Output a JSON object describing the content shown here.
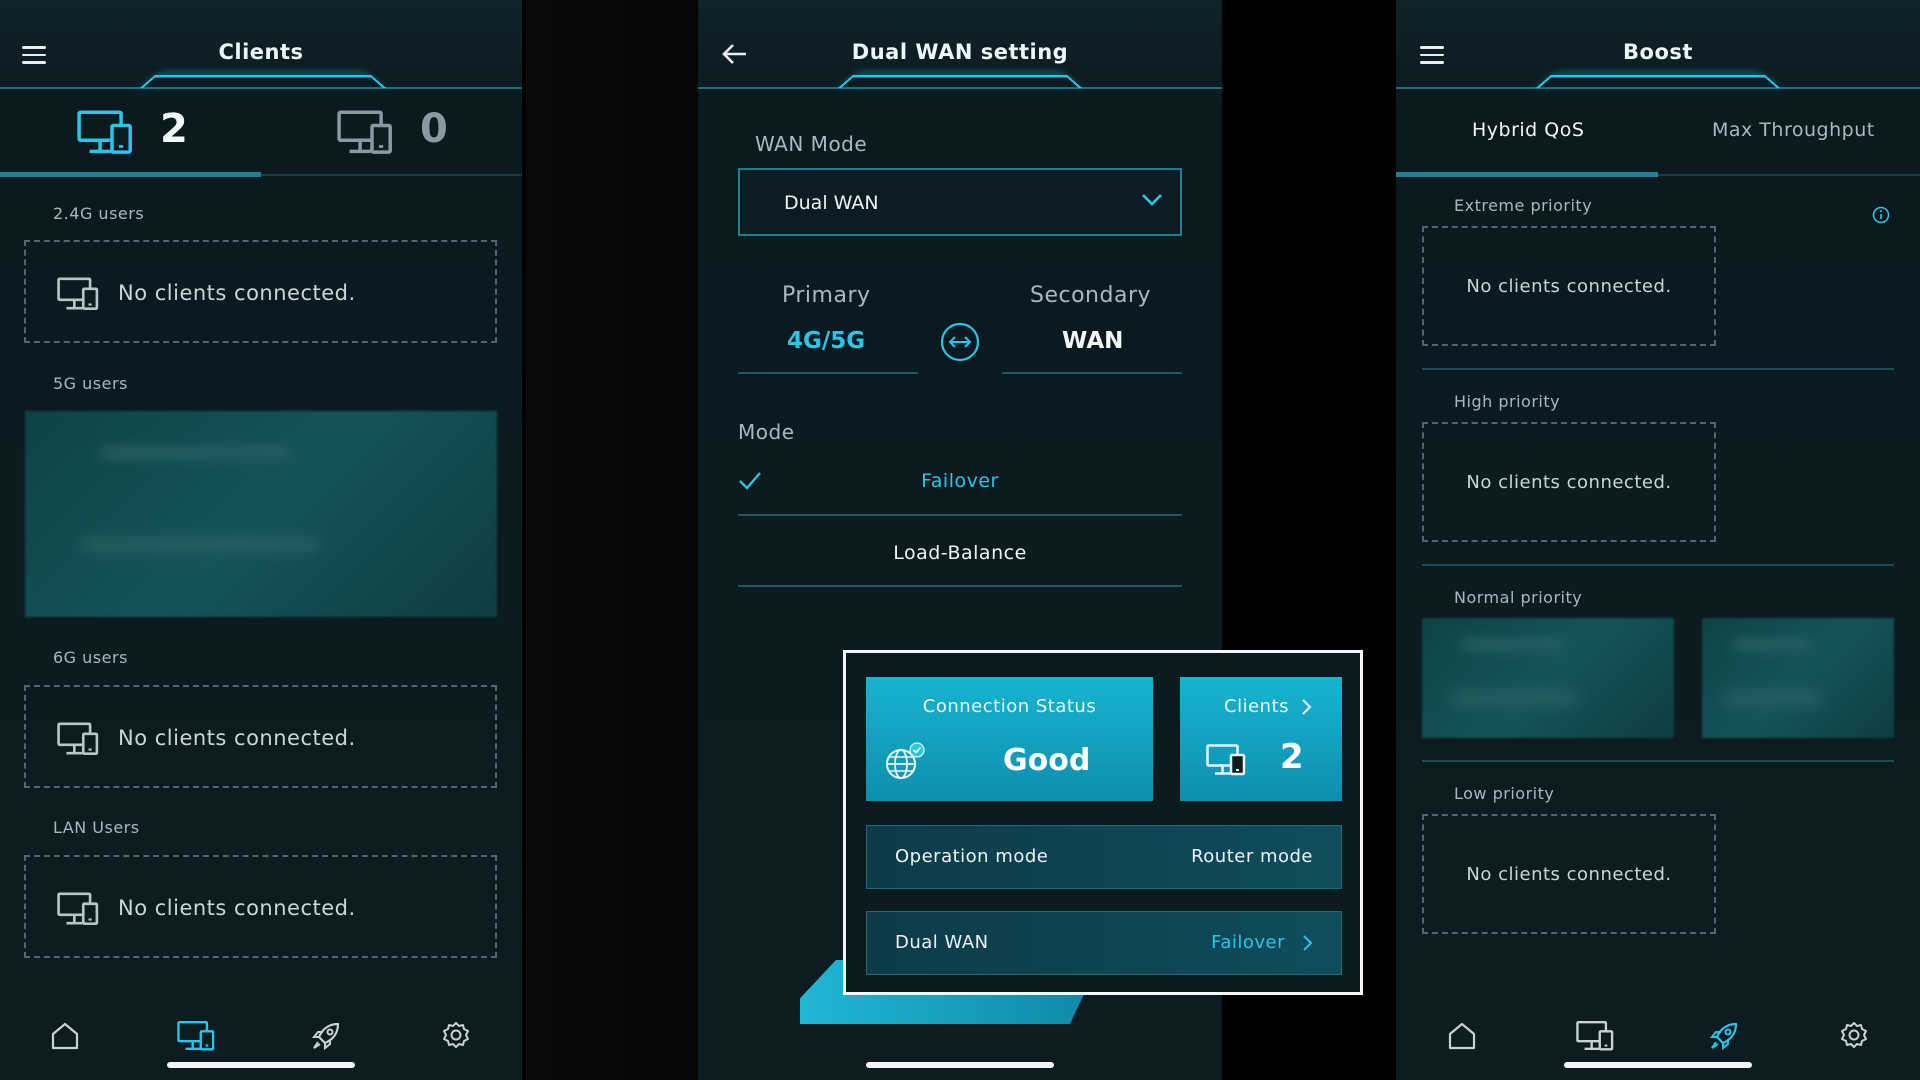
{
  "left": {
    "title": "Clients",
    "count_connected": "2",
    "count_other": "0",
    "sections": [
      {
        "label": "2.4G users",
        "empty_text": "No clients connected."
      },
      {
        "label": "5G users"
      },
      {
        "label": "6G users",
        "empty_text": "No clients connected."
      },
      {
        "label": "LAN Users",
        "empty_text": "No clients connected."
      }
    ],
    "nav": [
      "home-icon",
      "devices-icon",
      "rocket-icon",
      "gear-icon"
    ],
    "active_nav": "devices-icon"
  },
  "middle": {
    "title": "Dual WAN setting",
    "wan_mode_label": "WAN Mode",
    "wan_mode_value": "Dual WAN",
    "primary_label": "Primary",
    "primary_value": "4G/5G",
    "secondary_label": "Secondary",
    "secondary_value": "WAN",
    "mode_label": "Mode",
    "modes": [
      {
        "label": "Failover",
        "selected": true
      },
      {
        "label": "Load-Balance",
        "selected": false
      }
    ]
  },
  "overlay": {
    "connection_status_label": "Connection Status",
    "connection_status_value": "Good",
    "clients_label": "Clients",
    "clients_count": "2",
    "operation_mode_label": "Operation mode",
    "operation_mode_value": "Router mode",
    "dual_wan_label": "Dual WAN",
    "dual_wan_value": "Failover"
  },
  "right": {
    "title": "Boost",
    "tabs": [
      {
        "label": "Hybrid QoS",
        "active": true
      },
      {
        "label": "Max Throughput",
        "active": false
      }
    ],
    "priorities": [
      {
        "label": "Extreme priority",
        "empty_text": "No clients connected."
      },
      {
        "label": "High priority",
        "empty_text": "No clients connected."
      },
      {
        "label": "Normal priority"
      },
      {
        "label": "Low priority",
        "empty_text": "No clients connected."
      }
    ],
    "nav": [
      "home-icon",
      "devices-icon",
      "rocket-icon",
      "gear-icon"
    ],
    "active_nav": "rocket-icon"
  },
  "colors": {
    "accent": "#29c6ea",
    "panel_bg": "#0c1c21",
    "card": "#17b4d2"
  }
}
